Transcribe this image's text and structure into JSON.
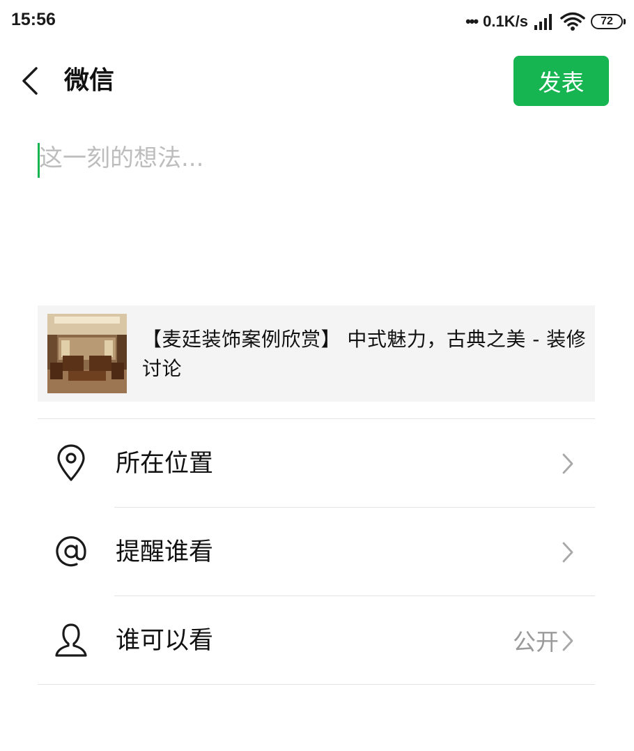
{
  "status_bar": {
    "time": "15:56",
    "net_dots": "•••",
    "net_speed": "0.1K/s",
    "battery": "72",
    "icons": [
      "signal-icon",
      "wifi-icon",
      "battery-icon"
    ]
  },
  "nav": {
    "back_icon": "back-arrow-icon",
    "title": "微信",
    "publish_label": "发表"
  },
  "composer": {
    "placeholder": "这一刻的想法...",
    "value": ""
  },
  "link_card": {
    "thumbnail": "interior-photo-thumbnail",
    "title": "【麦廷装饰案例欣赏】 中式魅力，古典之美 - 装修讨论"
  },
  "options": [
    {
      "icon": "location-pin-icon",
      "label": "所在位置",
      "value": ""
    },
    {
      "icon": "at-sign-icon",
      "label": "提醒谁看",
      "value": ""
    },
    {
      "icon": "person-icon",
      "label": "谁可以看",
      "value": "公开"
    }
  ],
  "colors": {
    "accent": "#17b551",
    "divider": "#e3e3e3",
    "card_bg": "#f4f4f4",
    "secondary_text": "#9a9a9a"
  }
}
